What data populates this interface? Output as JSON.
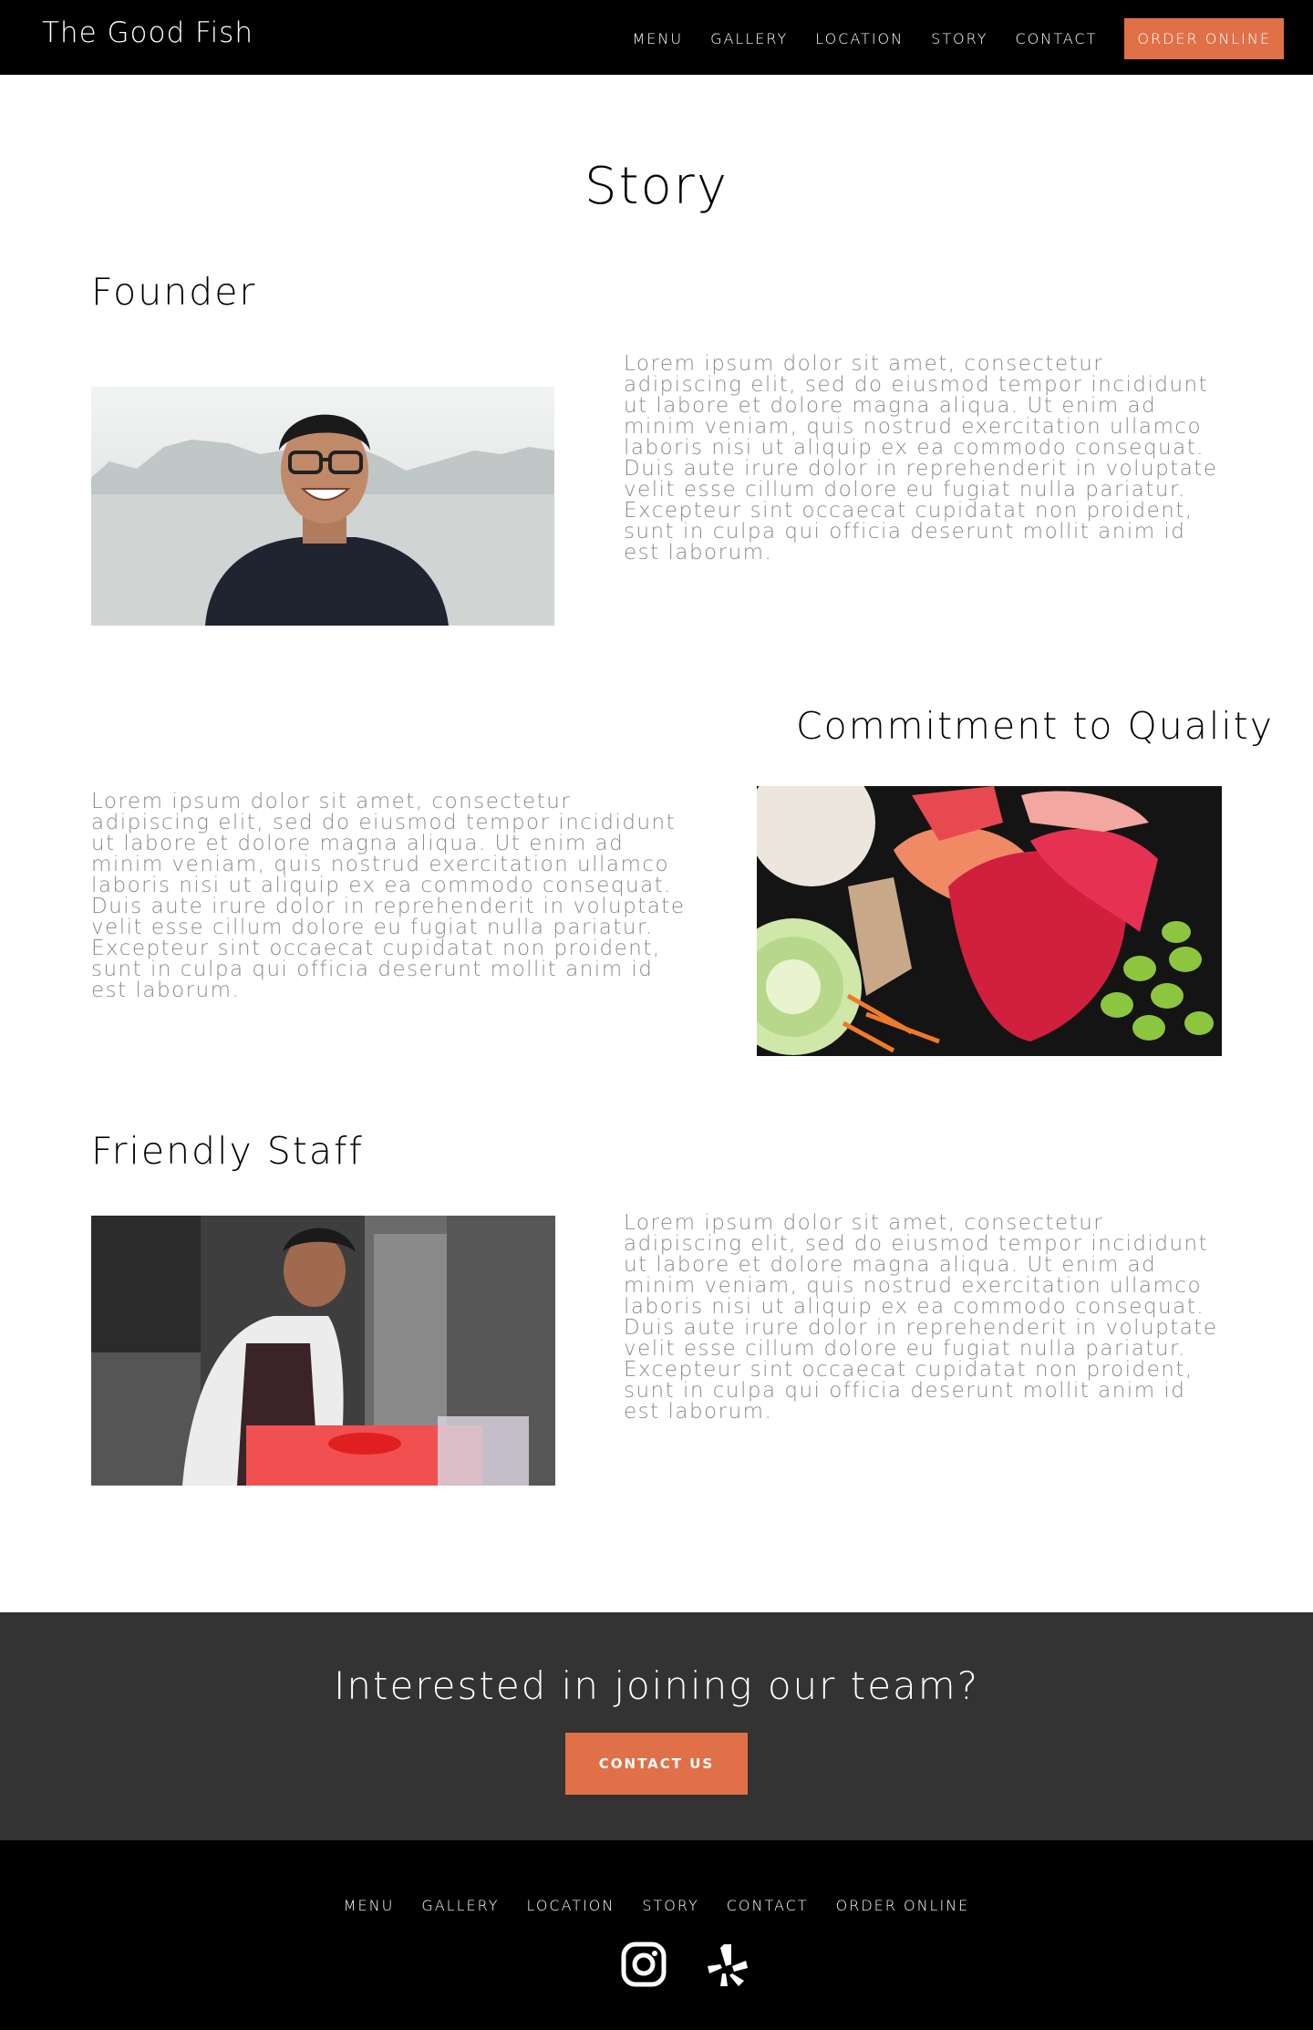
{
  "header": {
    "brand": "The Good Fish",
    "nav": [
      "MENU",
      "GALLERY",
      "LOCATION",
      "STORY",
      "CONTACT"
    ],
    "order_button": "ORDER ONLINE"
  },
  "main": {
    "title": "Story",
    "sections": [
      {
        "heading": "Founder",
        "text": "Lorem ipsum dolor sit amet, consectetur adipiscing elit, sed do eiusmod tempor incididunt ut labore et dolore magna aliqua. Ut enim ad minim veniam, quis nostrud exercitation ullamco laboris nisi ut aliquip ex ea commodo consequat. Duis aute irure dolor in reprehenderit in voluptate velit esse cillum dolore eu fugiat nulla pariatur. Excepteur sint occaecat cupidatat non proident, sunt in culpa qui officia deserunt mollit anim id est laborum."
      },
      {
        "heading": "Commitment to Quality",
        "text": "Lorem ipsum dolor sit amet, consectetur adipiscing elit, sed do eiusmod tempor incididunt ut labore et dolore magna aliqua. Ut enim ad minim veniam, quis nostrud exercitation ullamco laboris nisi ut aliquip ex ea commodo consequat. Duis aute irure dolor in reprehenderit in voluptate velit esse cillum dolore eu fugiat nulla pariatur. Excepteur sint occaecat cupidatat non proident, sunt in culpa qui officia deserunt mollit anim id est laborum."
      },
      {
        "heading": "Friendly Staff",
        "text": "Lorem ipsum dolor sit amet, consectetur adipiscing elit, sed do eiusmod tempor incididunt ut labore et dolore magna aliqua. Ut enim ad minim veniam, quis nostrud exercitation ullamco laboris nisi ut aliquip ex ea commodo consequat. Duis aute irure dolor in reprehenderit in voluptate velit esse cillum dolore eu fugiat nulla pariatur. Excepteur sint occaecat cupidatat non proident, sunt in culpa qui officia deserunt mollit anim id est laborum."
      }
    ]
  },
  "cta": {
    "title": "Interested in joining our team?",
    "button": "CONTACT US"
  },
  "footer": {
    "nav": [
      "MENU",
      "GALLERY",
      "LOCATION",
      "STORY",
      "CONTACT",
      "ORDER ONLINE"
    ],
    "icons": [
      "instagram-icon",
      "yelp-icon"
    ]
  },
  "colors": {
    "accent": "#e07047",
    "header_bg": "#000000",
    "cta_bg": "#333333",
    "body_text": "#8a8a8a"
  }
}
